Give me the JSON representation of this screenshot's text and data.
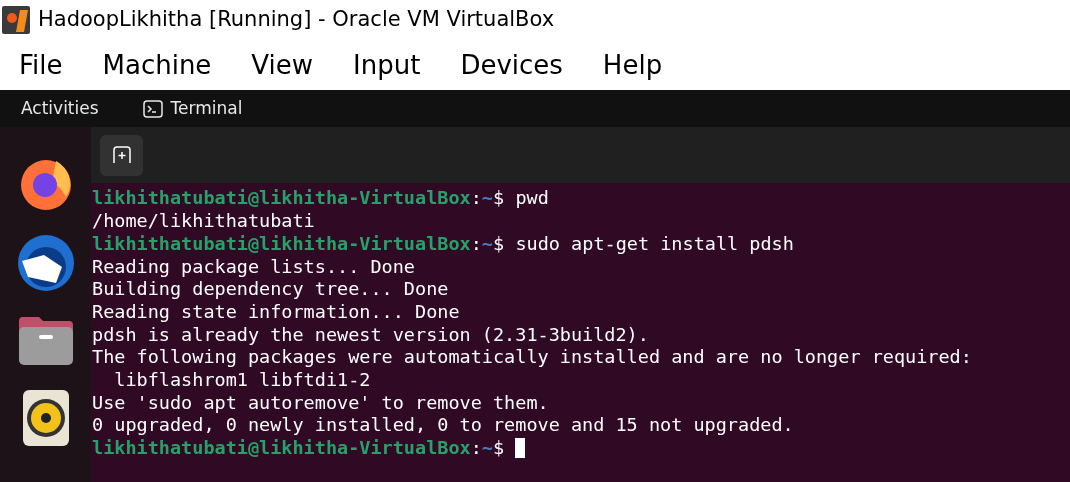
{
  "window": {
    "title": "HadoopLikhitha [Running] - Oracle VM VirtualBox"
  },
  "menu": [
    "File",
    "Machine",
    "View",
    "Input",
    "Devices",
    "Help"
  ],
  "top_bar": {
    "activities": "Activities",
    "app": "Terminal"
  },
  "terminal": {
    "lines": [
      {
        "kind": "prompt",
        "user": "likhithatubati@likhitha-VirtualBox",
        "separator": ":",
        "path": "~",
        "symbol": "$",
        "command": "pwd"
      },
      {
        "kind": "output",
        "text": "/home/likhithatubati"
      },
      {
        "kind": "prompt",
        "user": "likhithatubati@likhitha-VirtualBox",
        "separator": ":",
        "path": "~",
        "symbol": "$",
        "command": "sudo apt-get install pdsh"
      },
      {
        "kind": "output",
        "text": "Reading package lists... Done"
      },
      {
        "kind": "output",
        "text": "Building dependency tree... Done"
      },
      {
        "kind": "output",
        "text": "Reading state information... Done"
      },
      {
        "kind": "output",
        "text": "pdsh is already the newest version (2.31-3build2)."
      },
      {
        "kind": "output",
        "text": "The following packages were automatically installed and are no longer required:"
      },
      {
        "kind": "output",
        "text": "  libflashrom1 libftdi1-2"
      },
      {
        "kind": "output",
        "text": "Use 'sudo apt autoremove' to remove them."
      },
      {
        "kind": "output",
        "text": "0 upgraded, 0 newly installed, 0 to remove and 15 not upgraded."
      },
      {
        "kind": "prompt",
        "user": "likhithatubati@likhitha-VirtualBox",
        "separator": ":",
        "path": "~",
        "symbol": "$"
      }
    ]
  }
}
